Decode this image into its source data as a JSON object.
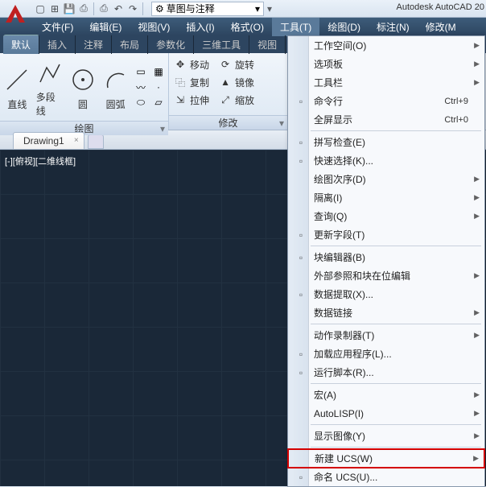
{
  "app_title": "Autodesk AutoCAD 20",
  "workspace": "草图与注释",
  "menus": [
    "文件(F)",
    "编辑(E)",
    "视图(V)",
    "插入(I)",
    "格式(O)",
    "工具(T)",
    "绘图(D)",
    "标注(N)",
    "修改(M"
  ],
  "ribbon_tabs": [
    "默认",
    "插入",
    "注释",
    "布局",
    "参数化",
    "三维工具",
    "视图"
  ],
  "draw_panel": {
    "title": "绘图",
    "tools": {
      "line": "直线",
      "pline": "多段线",
      "circle": "圆",
      "arc": "圆弧"
    }
  },
  "modify_panel": {
    "title": "修改",
    "move": "移动",
    "rotate": "旋转",
    "copy": "复制",
    "mirror": "镜像",
    "stretch": "拉伸",
    "scale": "缩放"
  },
  "doc_tab": "Drawing1",
  "viewport_label": "[-][俯视][二维线框]",
  "context_items": [
    {
      "label": "工作空间(O)",
      "arrow": true
    },
    {
      "label": "选项板",
      "arrow": true
    },
    {
      "label": "工具栏",
      "arrow": true
    },
    {
      "label": "命令行",
      "shortcut": "Ctrl+9",
      "icon": "cmd"
    },
    {
      "label": "全屏显示",
      "shortcut": "Ctrl+0"
    },
    {
      "sep": true
    },
    {
      "label": "拼写检查(E)",
      "icon": "abc"
    },
    {
      "label": "快速选择(K)...",
      "icon": "qsel"
    },
    {
      "label": "绘图次序(D)",
      "arrow": true
    },
    {
      "label": "隔离(I)",
      "arrow": true
    },
    {
      "label": "查询(Q)",
      "arrow": true
    },
    {
      "label": "更新字段(T)",
      "icon": "field"
    },
    {
      "sep": true
    },
    {
      "label": "块编辑器(B)",
      "icon": "block"
    },
    {
      "label": "外部参照和块在位编辑",
      "arrow": true
    },
    {
      "label": "数据提取(X)...",
      "icon": "extract"
    },
    {
      "label": "数据链接",
      "arrow": true
    },
    {
      "sep": true
    },
    {
      "label": "动作录制器(T)",
      "arrow": true
    },
    {
      "label": "加载应用程序(L)...",
      "icon": "load"
    },
    {
      "label": "运行脚本(R)...",
      "icon": "script"
    },
    {
      "sep": true
    },
    {
      "label": "宏(A)",
      "arrow": true
    },
    {
      "label": "AutoLISP(I)",
      "arrow": true
    },
    {
      "sep": true
    },
    {
      "label": "显示图像(Y)",
      "arrow": true
    },
    {
      "sep": true
    },
    {
      "label": "新建 UCS(W)",
      "arrow": true,
      "highlight": true
    },
    {
      "label": "命名 UCS(U)...",
      "icon": "ucs"
    }
  ]
}
